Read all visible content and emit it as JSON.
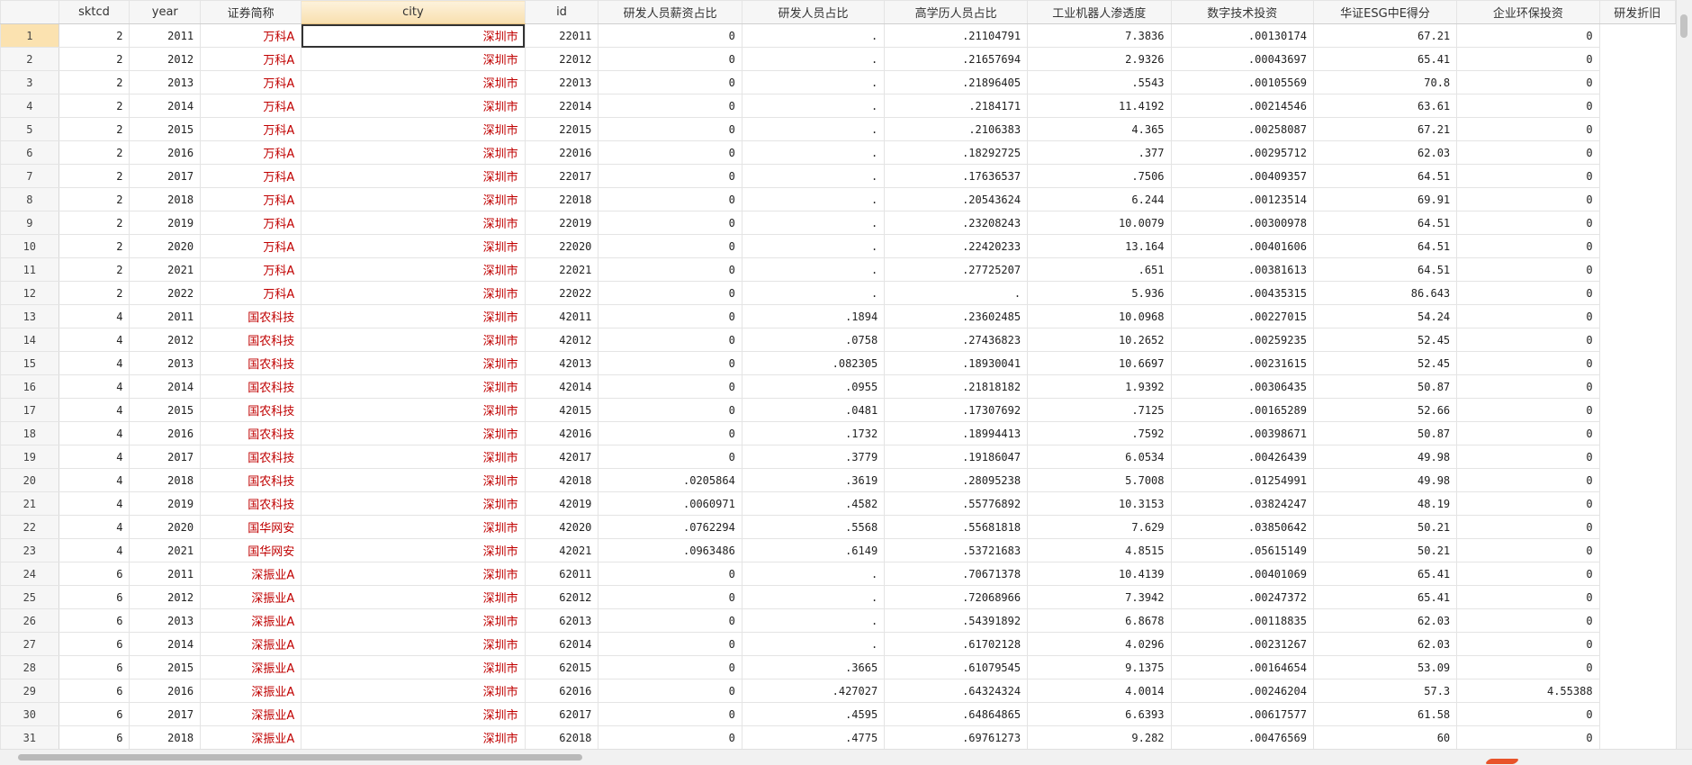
{
  "columns": [
    {
      "label": "sktcd",
      "width": 80
    },
    {
      "label": "year",
      "width": 80
    },
    {
      "label": "证券简称",
      "width": 114
    },
    {
      "label": "city",
      "width": 256,
      "sorted": true
    },
    {
      "label": "id",
      "width": 83
    },
    {
      "label": "研发人员薪资占比",
      "width": 161
    },
    {
      "label": "研发人员占比",
      "width": 161
    },
    {
      "label": "高学历人员占比",
      "width": 161
    },
    {
      "label": "工业机器人渗透度",
      "width": 161
    },
    {
      "label": "数字技术投资",
      "width": 161
    },
    {
      "label": "华证ESG中E得分",
      "width": 161
    },
    {
      "label": "企业环保投资",
      "width": 161
    },
    {
      "label": "研发折旧",
      "width": 85
    }
  ],
  "selected_row": 1,
  "active_col": 3,
  "rows": [
    [
      "1",
      "2",
      "2011",
      "万科A",
      "深圳市",
      "22011",
      "0",
      ".",
      ".21104791",
      "7.3836",
      ".00130174",
      "67.21",
      "0"
    ],
    [
      "2",
      "2",
      "2012",
      "万科A",
      "深圳市",
      "22012",
      "0",
      ".",
      ".21657694",
      "2.9326",
      ".00043697",
      "65.41",
      "0"
    ],
    [
      "3",
      "2",
      "2013",
      "万科A",
      "深圳市",
      "22013",
      "0",
      ".",
      ".21896405",
      ".5543",
      ".00105569",
      "70.8",
      "0"
    ],
    [
      "4",
      "2",
      "2014",
      "万科A",
      "深圳市",
      "22014",
      "0",
      ".",
      ".2184171",
      "11.4192",
      ".00214546",
      "63.61",
      "0"
    ],
    [
      "5",
      "2",
      "2015",
      "万科A",
      "深圳市",
      "22015",
      "0",
      ".",
      ".2106383",
      "4.365",
      ".00258087",
      "67.21",
      "0"
    ],
    [
      "6",
      "2",
      "2016",
      "万科A",
      "深圳市",
      "22016",
      "0",
      ".",
      ".18292725",
      ".377",
      ".00295712",
      "62.03",
      "0"
    ],
    [
      "7",
      "2",
      "2017",
      "万科A",
      "深圳市",
      "22017",
      "0",
      ".",
      ".17636537",
      ".7506",
      ".00409357",
      "64.51",
      "0"
    ],
    [
      "8",
      "2",
      "2018",
      "万科A",
      "深圳市",
      "22018",
      "0",
      ".",
      ".20543624",
      "6.244",
      ".00123514",
      "69.91",
      "0"
    ],
    [
      "9",
      "2",
      "2019",
      "万科A",
      "深圳市",
      "22019",
      "0",
      ".",
      ".23208243",
      "10.0079",
      ".00300978",
      "64.51",
      "0"
    ],
    [
      "10",
      "2",
      "2020",
      "万科A",
      "深圳市",
      "22020",
      "0",
      ".",
      ".22420233",
      "13.164",
      ".00401606",
      "64.51",
      "0"
    ],
    [
      "11",
      "2",
      "2021",
      "万科A",
      "深圳市",
      "22021",
      "0",
      ".",
      ".27725207",
      ".651",
      ".00381613",
      "64.51",
      "0"
    ],
    [
      "12",
      "2",
      "2022",
      "万科A",
      "深圳市",
      "22022",
      "0",
      ".",
      ".",
      "5.936",
      ".00435315",
      "86.643",
      "0"
    ],
    [
      "13",
      "4",
      "2011",
      "国农科技",
      "深圳市",
      "42011",
      "0",
      ".1894",
      ".23602485",
      "10.0968",
      ".00227015",
      "54.24",
      "0"
    ],
    [
      "14",
      "4",
      "2012",
      "国农科技",
      "深圳市",
      "42012",
      "0",
      ".0758",
      ".27436823",
      "10.2652",
      ".00259235",
      "52.45",
      "0"
    ],
    [
      "15",
      "4",
      "2013",
      "国农科技",
      "深圳市",
      "42013",
      "0",
      ".082305",
      ".18930041",
      "10.6697",
      ".00231615",
      "52.45",
      "0"
    ],
    [
      "16",
      "4",
      "2014",
      "国农科技",
      "深圳市",
      "42014",
      "0",
      ".0955",
      ".21818182",
      "1.9392",
      ".00306435",
      "50.87",
      "0"
    ],
    [
      "17",
      "4",
      "2015",
      "国农科技",
      "深圳市",
      "42015",
      "0",
      ".0481",
      ".17307692",
      ".7125",
      ".00165289",
      "52.66",
      "0"
    ],
    [
      "18",
      "4",
      "2016",
      "国农科技",
      "深圳市",
      "42016",
      "0",
      ".1732",
      ".18994413",
      ".7592",
      ".00398671",
      "50.87",
      "0"
    ],
    [
      "19",
      "4",
      "2017",
      "国农科技",
      "深圳市",
      "42017",
      "0",
      ".3779",
      ".19186047",
      "6.0534",
      ".00426439",
      "49.98",
      "0"
    ],
    [
      "20",
      "4",
      "2018",
      "国农科技",
      "深圳市",
      "42018",
      ".0205864",
      ".3619",
      ".28095238",
      "5.7008",
      ".01254991",
      "49.98",
      "0"
    ],
    [
      "21",
      "4",
      "2019",
      "国农科技",
      "深圳市",
      "42019",
      ".0060971",
      ".4582",
      ".55776892",
      "10.3153",
      ".03824247",
      "48.19",
      "0"
    ],
    [
      "22",
      "4",
      "2020",
      "国华网安",
      "深圳市",
      "42020",
      ".0762294",
      ".5568",
      ".55681818",
      "7.629",
      ".03850642",
      "50.21",
      "0"
    ],
    [
      "23",
      "4",
      "2021",
      "国华网安",
      "深圳市",
      "42021",
      ".0963486",
      ".6149",
      ".53721683",
      "4.8515",
      ".05615149",
      "50.21",
      "0"
    ],
    [
      "24",
      "6",
      "2011",
      "深振业A",
      "深圳市",
      "62011",
      "0",
      ".",
      ".70671378",
      "10.4139",
      ".00401069",
      "65.41",
      "0"
    ],
    [
      "25",
      "6",
      "2012",
      "深振业A",
      "深圳市",
      "62012",
      "0",
      ".",
      ".72068966",
      "7.3942",
      ".00247372",
      "65.41",
      "0"
    ],
    [
      "26",
      "6",
      "2013",
      "深振业A",
      "深圳市",
      "62013",
      "0",
      ".",
      ".54391892",
      "6.8678",
      ".00118835",
      "62.03",
      "0"
    ],
    [
      "27",
      "6",
      "2014",
      "深振业A",
      "深圳市",
      "62014",
      "0",
      ".",
      ".61702128",
      "4.0296",
      ".00231267",
      "62.03",
      "0"
    ],
    [
      "28",
      "6",
      "2015",
      "深振业A",
      "深圳市",
      "62015",
      "0",
      ".3665",
      ".61079545",
      "9.1375",
      ".00164654",
      "53.09",
      "0"
    ],
    [
      "29",
      "6",
      "2016",
      "深振业A",
      "深圳市",
      "62016",
      "0",
      ".427027",
      ".64324324",
      "4.0014",
      ".00246204",
      "57.3",
      "4.55388"
    ],
    [
      "30",
      "6",
      "2017",
      "深振业A",
      "深圳市",
      "62017",
      "0",
      ".4595",
      ".64864865",
      "6.6393",
      ".00617577",
      "61.58",
      "0"
    ],
    [
      "31",
      "6",
      "2018",
      "深振业A",
      "深圳市",
      "62018",
      "0",
      ".4775",
      ".69761273",
      "9.282",
      ".00476569",
      "60",
      "0"
    ]
  ]
}
